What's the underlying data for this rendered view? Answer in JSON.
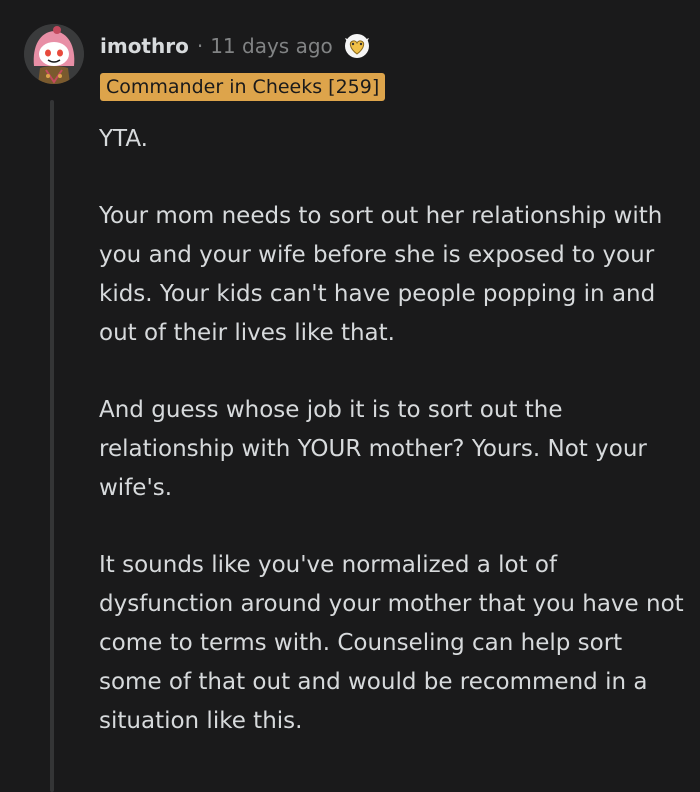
{
  "comment": {
    "author": "imothro",
    "separator": "·",
    "time_ago": "11 days ago",
    "award_icon": "wholesome-heart-award-icon",
    "flair": "Commander in Cheeks [259]",
    "paragraphs": [
      "YTA.",
      "Your mom needs to sort out her relationship with you and your wife before she is exposed to your kids. Your kids can't have people popping in and out of their lives like that.",
      "And guess whose job it is to sort out the relationship with YOUR mother? Yours. Not your wife's.",
      "It sounds like you've normalized a lot of dysfunction around your mother that you have not come to terms with. Counseling can help sort some of that out and would be recommend in a situation like this."
    ]
  },
  "colors": {
    "background": "#1a1a1b",
    "text": "#d7dadc",
    "muted": "#818384",
    "flair_bg": "#dda44b",
    "thread_line": "#343536"
  }
}
